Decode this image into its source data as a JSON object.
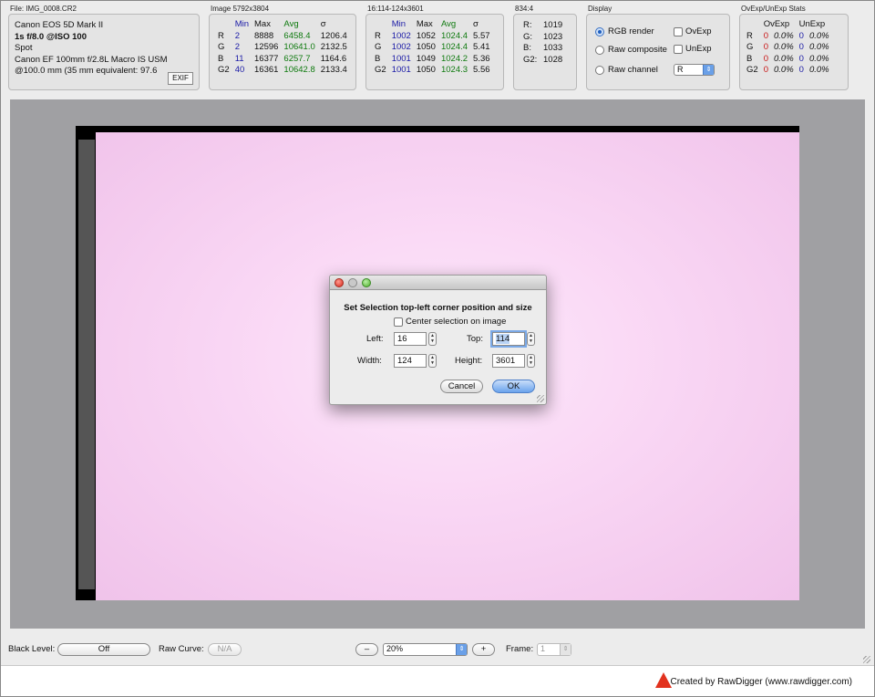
{
  "file_panel": {
    "title": "File: IMG_0008.CR2",
    "camera": "Canon EOS 5D Mark II",
    "exposure": "1s f/8.0 @ISO 100",
    "metering": "Spot",
    "lens": "Canon EF 100mm f/2.8L Macro IS USM",
    "focal": "@100.0 mm (35 mm equivalent: 97.6",
    "exif_button": "EXIF"
  },
  "image_panel": {
    "title": "Image 5792x3804",
    "headers": [
      "Min",
      "Max",
      "Avg",
      "σ"
    ],
    "rows": [
      {
        "ch": "R",
        "min": "2",
        "max": "8888",
        "avg": "6458.4",
        "sd": "1206.4"
      },
      {
        "ch": "G",
        "min": "2",
        "max": "12596",
        "avg": "10641.0",
        "sd": "2132.5"
      },
      {
        "ch": "B",
        "min": "11",
        "max": "16377",
        "avg": "6257.7",
        "sd": "1164.6"
      },
      {
        "ch": "G2",
        "min": "40",
        "max": "16361",
        "avg": "10642.8",
        "sd": "2133.4"
      }
    ]
  },
  "selection_panel": {
    "title": "16:114-124x3601",
    "headers": [
      "Min",
      "Max",
      "Avg",
      "σ"
    ],
    "rows": [
      {
        "ch": "R",
        "min": "1002",
        "max": "1052",
        "avg": "1024.4",
        "sd": "5.57"
      },
      {
        "ch": "G",
        "min": "1002",
        "max": "1050",
        "avg": "1024.4",
        "sd": "5.41"
      },
      {
        "ch": "B",
        "min": "1001",
        "max": "1049",
        "avg": "1024.2",
        "sd": "5.36"
      },
      {
        "ch": "G2",
        "min": "1001",
        "max": "1050",
        "avg": "1024.3",
        "sd": "5.56"
      }
    ]
  },
  "pixel_panel": {
    "title": "834:4",
    "rows": [
      {
        "ch": "R:",
        "val": "1019"
      },
      {
        "ch": "G:",
        "val": "1023"
      },
      {
        "ch": "B:",
        "val": "1033"
      },
      {
        "ch": "G2:",
        "val": "1028"
      }
    ]
  },
  "display_panel": {
    "title": "Display",
    "rgb_render": "RGB render",
    "raw_composite": "Raw composite",
    "raw_channel": "Raw channel",
    "ovexp": "OvExp",
    "unexp": "UnExp",
    "channel_value": "R"
  },
  "ovexp_panel": {
    "title": "OvExp/UnExp Stats",
    "headers": [
      "OvExp",
      "UnExp"
    ],
    "rows": [
      {
        "ch": "R",
        "ov": "0",
        "ovp": "0.0%",
        "un": "0",
        "unp": "0.0%"
      },
      {
        "ch": "G",
        "ov": "0",
        "ovp": "0.0%",
        "un": "0",
        "unp": "0.0%"
      },
      {
        "ch": "B",
        "ov": "0",
        "ovp": "0.0%",
        "un": "0",
        "unp": "0.0%"
      },
      {
        "ch": "G2",
        "ov": "0",
        "ovp": "0.0%",
        "un": "0",
        "unp": "0.0%"
      }
    ]
  },
  "dialog": {
    "title": "Set Selection top-left corner position and size",
    "center_checkbox": "Center selection on image",
    "left_label": "Left:",
    "left_value": "16",
    "top_label": "Top:",
    "top_value": "114",
    "width_label": "Width:",
    "width_value": "124",
    "height_label": "Height:",
    "height_value": "3601",
    "cancel": "Cancel",
    "ok": "OK"
  },
  "bottom": {
    "black_level_label": "Black Level:",
    "black_level_value": "Off",
    "raw_curve_label": "Raw Curve:",
    "raw_curve_value": "N/A",
    "zoom_minus": "–",
    "zoom_value": "20%",
    "zoom_plus": "+",
    "frame_label": "Frame:",
    "frame_value": "1"
  },
  "footer": {
    "text": "Created by RawDigger (www.rawdigger.com)"
  },
  "colors": {
    "min_blue": "#1a1aa6",
    "avg_green": "#0f7a0f",
    "ovexp_red": "#c81414",
    "logo_red": "#e2321e"
  }
}
